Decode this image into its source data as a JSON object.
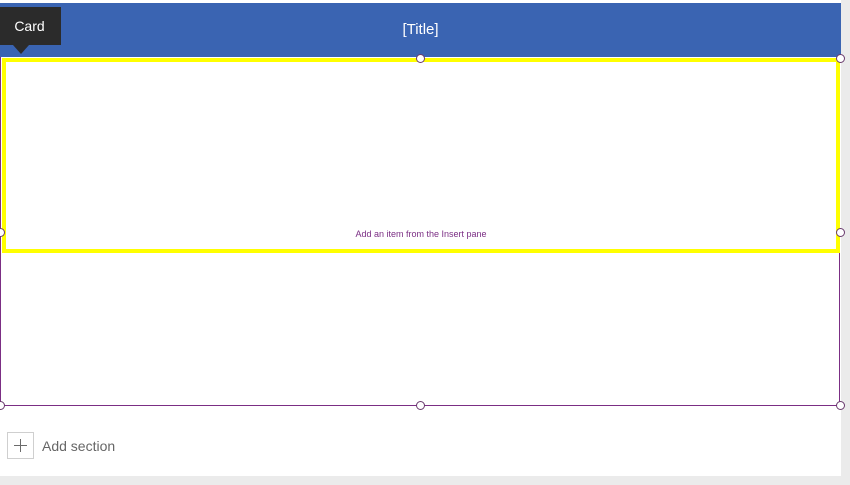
{
  "header": {
    "title": "[Title]",
    "background_color": "#3a64b2"
  },
  "tooltip": {
    "label": "Card"
  },
  "card": {
    "placeholder": "Add an item from the Insert pane",
    "selection_color": "#ffff00"
  },
  "form": {
    "border_color": "#7b2e84"
  },
  "footer": {
    "add_section_label": "Add section",
    "add_icon": "plus-icon"
  }
}
